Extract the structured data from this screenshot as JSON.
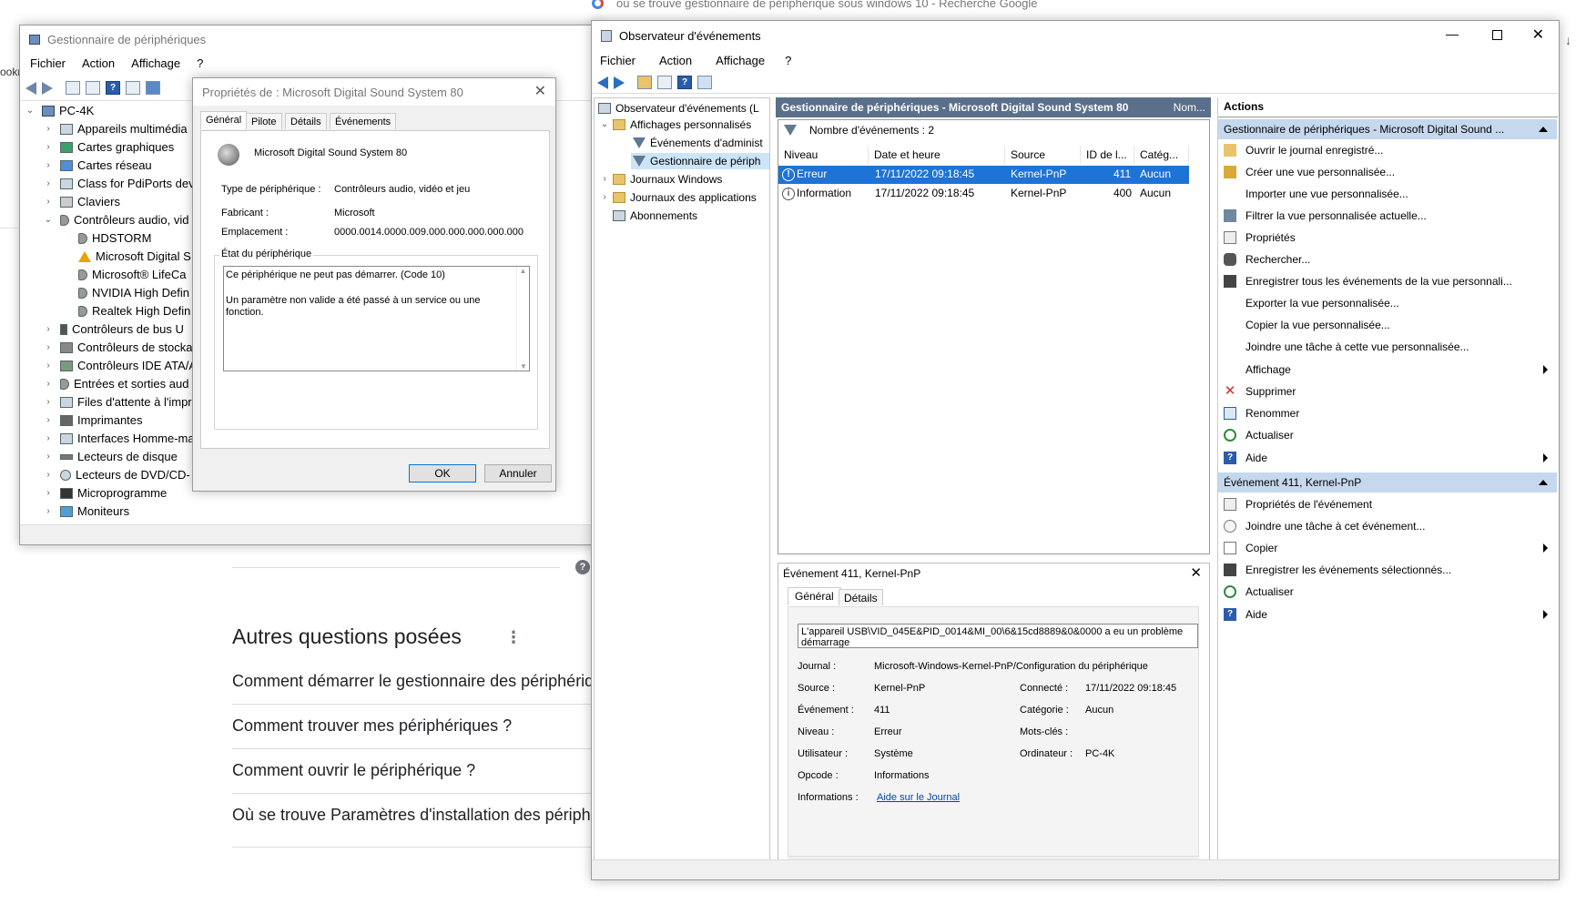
{
  "browser": {
    "search_tab_title": "où se trouve gestionnaire de périphérique sous windows 10 - Recherche Google",
    "left_fragment": "ookr"
  },
  "google": {
    "heading": "Autres questions posées",
    "questions": [
      "Comment démarrer le gestionnaire des périphériq",
      "Comment trouver mes périphériques ?",
      "Comment ouvrir le périphérique ?",
      "Où se trouve Paramètres d'installation des périph"
    ],
    "help_icon": "?"
  },
  "devmgr": {
    "title": "Gestionnaire de périphériques",
    "menu": [
      "Fichier",
      "Action",
      "Affichage",
      "?"
    ],
    "tree": {
      "root": "PC-4K",
      "items": [
        "Appareils multimédia",
        "Cartes graphiques",
        "Cartes réseau",
        "Class for PdiPorts dev",
        "Claviers",
        "Contrôleurs audio, vid",
        "HDSTORM",
        "Microsoft Digital S",
        "Microsoft® LifeCa",
        "NVIDIA High Defin",
        "Realtek High Defin",
        "Contrôleurs de bus U",
        "Contrôleurs de stocka",
        "Contrôleurs IDE ATA/A",
        "Entrées et sorties aud",
        "Files d'attente à l'impr",
        "Imprimantes",
        "Interfaces Homme-ma",
        "Lecteurs de disque",
        "Lecteurs de DVD/CD-",
        "Microprogramme",
        "Moniteurs"
      ]
    }
  },
  "props": {
    "title": "Propriétés de : Microsoft Digital Sound System 80",
    "tabs": [
      "Général",
      "Pilote",
      "Détails",
      "Événements"
    ],
    "device_name": "Microsoft Digital Sound System 80",
    "type_label": "Type de périphérique :",
    "type_value": "Contrôleurs audio, vidéo et jeu",
    "maker_label": "Fabricant :",
    "maker_value": "Microsoft",
    "loc_label": "Emplacement :",
    "loc_value": "0000.0014.0000.009.000.000.000.000.000",
    "status_group": "État du périphérique",
    "status_line1": "Ce périphérique ne peut pas démarrer. (Code 10)",
    "status_line2": "Un paramètre non valide a été passé à un service ou une fonction.",
    "ok": "OK",
    "cancel": "Annuler"
  },
  "ev": {
    "title": "Observateur d'événements",
    "menu": [
      "Fichier",
      "Action",
      "Affichage",
      "?"
    ],
    "tree": [
      "Observateur d'événements (L",
      "Affichages personnalisés",
      "Événements d'administ",
      "Gestionnaire de périph",
      "Journaux Windows",
      "Journaux des applications",
      "Abonnements"
    ],
    "center_title": "Gestionnaire de périphériques - Microsoft Digital Sound System 80",
    "center_title_more": "Nom...",
    "count_label": "Nombre d'événements : 2",
    "columns": [
      "Niveau",
      "Date et heure",
      "Source",
      "ID de l...",
      "Catég..."
    ],
    "rows": [
      {
        "level": "Erreur",
        "date": "17/11/2022 09:18:45",
        "source": "Kernel-PnP",
        "id": "411",
        "cat": "Aucun"
      },
      {
        "level": "Information",
        "date": "17/11/2022 09:18:45",
        "source": "Kernel-PnP",
        "id": "400",
        "cat": "Aucun"
      }
    ],
    "detail": {
      "header": "Événement 411, Kernel-PnP",
      "tabs": [
        "Général",
        "Détails"
      ],
      "message": "L'appareil USB\\VID_045E&PID_0014&MI_00\\6&15cd8889&0&0000 a eu un problème",
      "message_cont": "démarrage",
      "journal_label": "Journal :",
      "journal_value": "Microsoft-Windows-Kernel-PnP/Configuration du périphérique",
      "source_label": "Source :",
      "source_value": "Kernel-PnP",
      "connected_label": "Connecté :",
      "connected_value": "17/11/2022 09:18:45",
      "event_label": "Événement :",
      "event_value": "411",
      "category_label": "Catégorie :",
      "category_value": "Aucun",
      "level_label": "Niveau :",
      "level_value": "Erreur",
      "keywords_label": "Mots-clés :",
      "user_label": "Utilisateur :",
      "user_value": "Système",
      "computer_label": "Ordinateur :",
      "computer_value": "PC-4K",
      "opcode_label": "Opcode :",
      "opcode_value": "Informations",
      "info_label": "Informations :",
      "info_link": "Aide sur le Journal"
    },
    "actions": {
      "title": "Actions",
      "section1": "Gestionnaire de périphériques - Microsoft Digital Sound ...",
      "items1": [
        "Ouvrir le journal enregistré...",
        "Créer une vue personnalisée...",
        "Importer une vue personnalisée...",
        "Filtrer la vue personnalisée actuelle...",
        "Propriétés",
        "Rechercher...",
        "Enregistrer tous les événements de la vue personnali...",
        "Exporter la vue personnalisée...",
        "Copier la vue personnalisée...",
        "Joindre une tâche à cette vue personnalisée...",
        "Affichage",
        "Supprimer",
        "Renommer",
        "Actualiser",
        "Aide"
      ],
      "section2": "Événement 411, Kernel-PnP",
      "items2": [
        "Propriétés de l'événement",
        "Joindre une tâche à cet événement...",
        "Copier",
        "Enregistrer les événements sélectionnés...",
        "Actualiser",
        "Aide"
      ]
    }
  }
}
